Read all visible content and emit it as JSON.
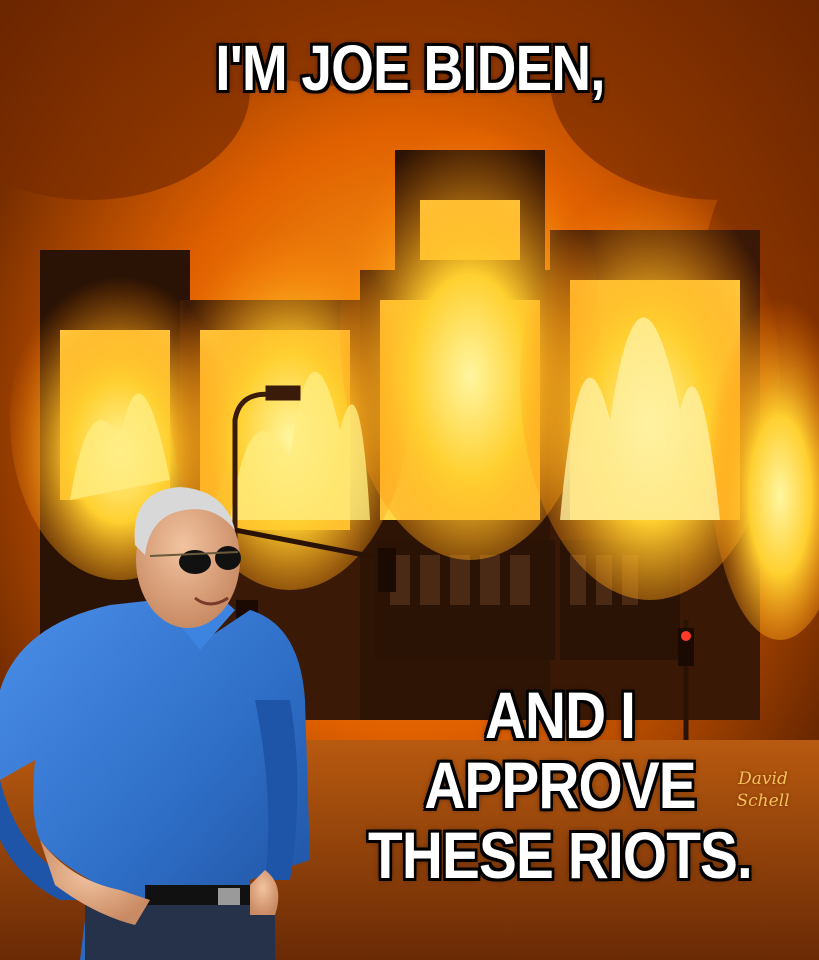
{
  "meme": {
    "top_text": "I'M JOE BIDEN,",
    "bottom_lines": [
      "AND I",
      "APPROVE",
      "THESE RIOTS."
    ],
    "watermark_lines": [
      "David",
      "Schell"
    ]
  },
  "colors": {
    "fire_core": "#ffe46a",
    "fire_orange": "#ff8a00",
    "smoke": "#5a1e00",
    "shirt_blue": "#2f74d0",
    "caption_text": "#ffffff",
    "caption_outline": "#000000"
  }
}
